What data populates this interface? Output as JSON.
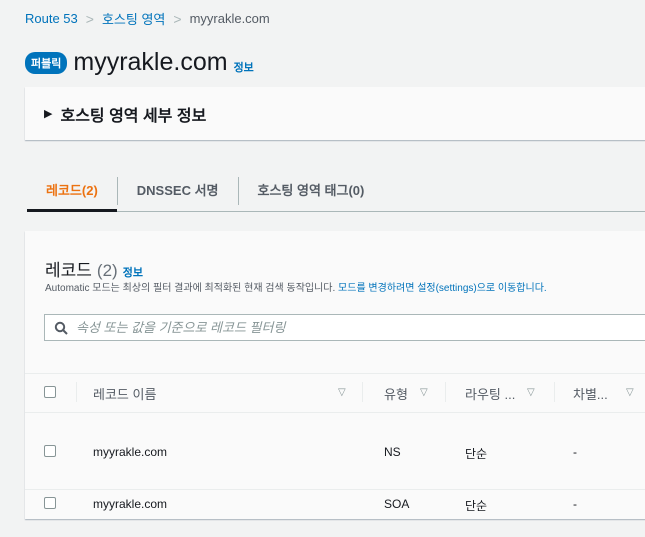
{
  "breadcrumb": [
    "Route 53",
    "호스팅 영역",
    "myyrakle.com"
  ],
  "header": {
    "badge": "퍼블릭",
    "title": "myyrakle.com",
    "info": "정보"
  },
  "details_expander": "호스팅 영역 세부 정보",
  "tabs": [
    {
      "label": "레코드(2)",
      "active": true
    },
    {
      "label": "DNSSEC 서명"
    },
    {
      "label": "호스팅 영역 태그(0)"
    }
  ],
  "records": {
    "title": "레코드",
    "count": "(2)",
    "info": "정보",
    "desc": "Automatic 모드는 최상의 필터 결과에 최적화된 현재 검색 동작입니다. ",
    "desc_link": "모드를 변경하려면 설정(settings)으로 이동합니다.",
    "search_placeholder": "속성 또는 값을 기준으로 레코드 필터링",
    "columns": [
      "레코드 이름",
      "유형",
      "라우팅 ...",
      "차별..."
    ],
    "rows": [
      {
        "name": "myyrakle.com",
        "type": "NS",
        "routing": "단순",
        "diff": "-"
      },
      {
        "name": "myyrakle.com",
        "type": "SOA",
        "routing": "단순",
        "diff": "-"
      }
    ]
  }
}
